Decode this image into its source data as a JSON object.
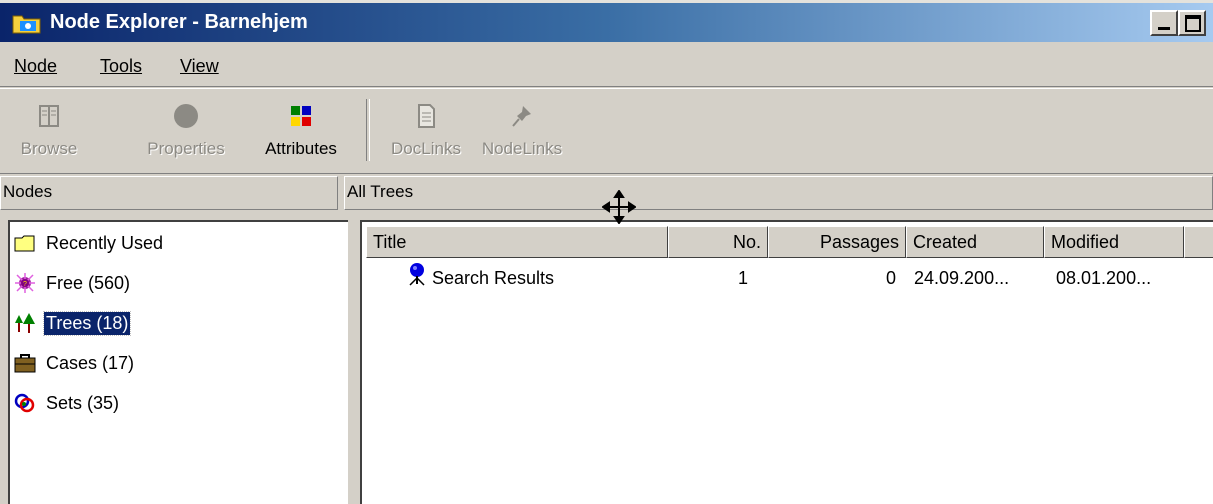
{
  "window": {
    "title": "Node Explorer - Barnehjem"
  },
  "menu": {
    "items": [
      {
        "label": "Node",
        "underline": "N"
      },
      {
        "label": "Tools",
        "underline": "T"
      },
      {
        "label": "View",
        "underline": "V"
      }
    ]
  },
  "toolbar": {
    "buttons": [
      {
        "label": "Browse",
        "icon": "book-icon",
        "enabled": false
      },
      {
        "label": "Properties",
        "icon": "circle-icon",
        "enabled": false
      },
      {
        "label": "Attributes",
        "icon": "color-grid-icon",
        "enabled": true
      },
      {
        "label": "DocLinks",
        "icon": "document-icon",
        "enabled": false
      },
      {
        "label": "NodeLinks",
        "icon": "pin-icon",
        "enabled": false
      }
    ]
  },
  "left_pane": {
    "header": "Nodes",
    "items": [
      {
        "label": "Recently Used",
        "icon": "folder-icon",
        "selected": false
      },
      {
        "label": "Free (560)",
        "icon": "free-node-icon",
        "selected": false
      },
      {
        "label": "Trees (18)",
        "icon": "trees-icon",
        "selected": true
      },
      {
        "label": "Cases (17)",
        "icon": "briefcase-icon",
        "selected": false
      },
      {
        "label": "Sets (35)",
        "icon": "sets-icon",
        "selected": false
      }
    ]
  },
  "right_pane": {
    "header": "All Trees",
    "columns": [
      "Title",
      "No.",
      "Passages",
      "Created",
      "Modified"
    ],
    "rows": [
      {
        "title": "Search Results",
        "no": "1",
        "passages": "0",
        "created": "24.09.200...",
        "modified": "08.01.200...",
        "icon": "tree-node-icon"
      }
    ]
  },
  "colors": {
    "titlebar_start": "#0a246a",
    "titlebar_end": "#a6caf0",
    "selection": "#0a246a",
    "face": "#d4d0c8"
  }
}
